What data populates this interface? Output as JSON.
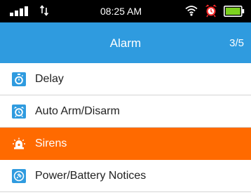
{
  "status_bar": {
    "time": "08:25 AM",
    "icons": [
      "signal-icon",
      "data-arrows-icon",
      "wifi-icon",
      "alarm-clock-icon",
      "battery-icon"
    ],
    "battery_color": "#7cd11f"
  },
  "header": {
    "title": "Alarm",
    "page": "3/5",
    "color": "#2f9bdf"
  },
  "menu": {
    "items": [
      {
        "label": "Delay",
        "icon": "stopwatch-icon",
        "selected": false
      },
      {
        "label": "Auto Arm/Disarm",
        "icon": "alarm-clock-icon",
        "selected": false
      },
      {
        "label": "Sirens",
        "icon": "siren-icon",
        "selected": true
      },
      {
        "label": "Power/Battery Notices",
        "icon": "power-battery-icon",
        "selected": false
      }
    ],
    "selected_color": "#ff6a00"
  }
}
